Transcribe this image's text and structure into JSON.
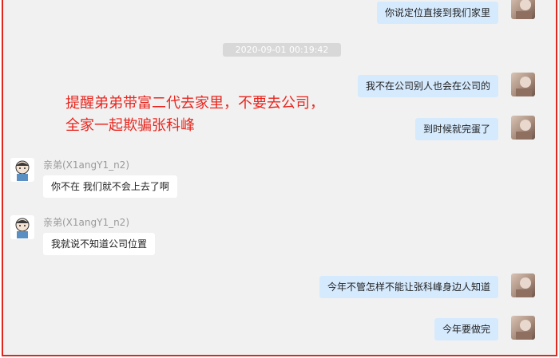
{
  "timestamp": "2020-09-01 00:19:42",
  "annotation": {
    "line1": "提醒弟弟带富二代去家里，不要去公司，",
    "line2": "全家一起欺骗张科峰"
  },
  "messages": [
    {
      "side": "out",
      "text": "你说定位直接到我们家里"
    },
    {
      "side": "out",
      "text": "我不在公司别人也会在公司的"
    },
    {
      "side": "out",
      "text": "到时候就完蛋了"
    },
    {
      "side": "in",
      "sender": "亲弟(X1angY1_n2)",
      "text": "你不在 我们就不会上去了啊"
    },
    {
      "side": "in",
      "sender": "亲弟(X1angY1_n2)",
      "text": "我就说不知道公司位置"
    },
    {
      "side": "out",
      "text": "今年不管怎样不能让张科峰身边人知道"
    },
    {
      "side": "out",
      "text": "今年要做完"
    }
  ],
  "colors": {
    "frame_border": "#e0271f",
    "annotation": "#e8271f",
    "outgoing_bubble": "#d6eafe",
    "incoming_bubble": "#ffffff",
    "background": "#f1f1f1"
  }
}
